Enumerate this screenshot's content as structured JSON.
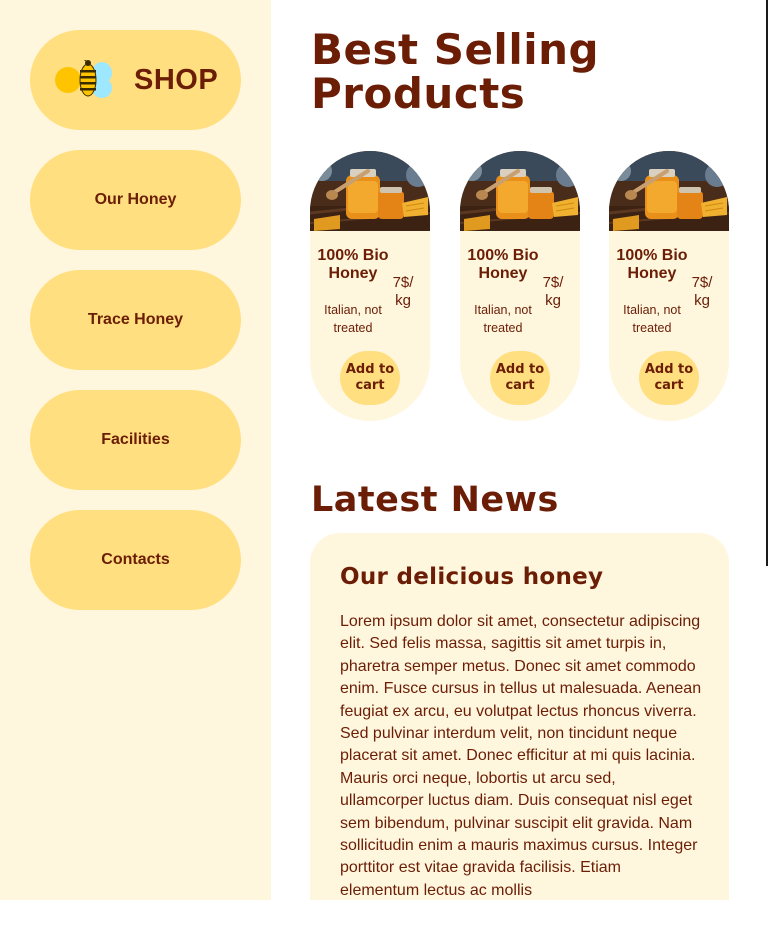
{
  "nav": {
    "shop_label": "SHOP",
    "items": [
      {
        "label": "Our Honey"
      },
      {
        "label": "Trace Honey"
      },
      {
        "label": "Facilities"
      },
      {
        "label": "Contacts"
      }
    ]
  },
  "products": {
    "heading": "Best Selling Products",
    "items": [
      {
        "name": "100% Bio Honey",
        "desc": "Italian, not treated",
        "price": "7$/ kg",
        "button": "Add to cart"
      },
      {
        "name": "100% Bio Honey",
        "desc": "Italian, not treated",
        "price": "7$/ kg",
        "button": "Add to cart"
      },
      {
        "name": "100% Bio Honey",
        "desc": "Italian, not treated",
        "price": "7$/ kg",
        "button": "Add to cart"
      }
    ]
  },
  "news": {
    "heading": "Latest News",
    "article_title": "Our delicious honey",
    "article_body": "Lorem ipsum dolor sit amet, consectetur adipiscing elit. Sed felis massa, sagittis sit amet turpis in, pharetra semper metus. Donec sit amet commodo enim. Fusce cursus in tellus ut malesuada. Aenean feugiat ex arcu, eu volutpat lectus rhoncus viverra. Sed pulvinar interdum velit, non tincidunt neque placerat sit amet. Donec efficitur at mi quis lacinia. Mauris orci neque, lobortis ut arcu sed, ullamcorper luctus diam. Duis consequat nisl eget sem bibendum, pulvinar suscipit elit gravida. Nam sollicitudin enim a mauris maximus cursus. Integer porttitor est vitae gravida facilisis. Etiam elementum lectus ac mollis"
  },
  "colors": {
    "text": "#6b1d05",
    "sidebar_bg": "#fff6de",
    "pill": "#ffdf7f",
    "bee_yellow": "#ffc400",
    "bee_wing": "#9ee8ff"
  },
  "icons": {
    "logo": "bee-icon",
    "product_image": "honey-jar-photo"
  }
}
